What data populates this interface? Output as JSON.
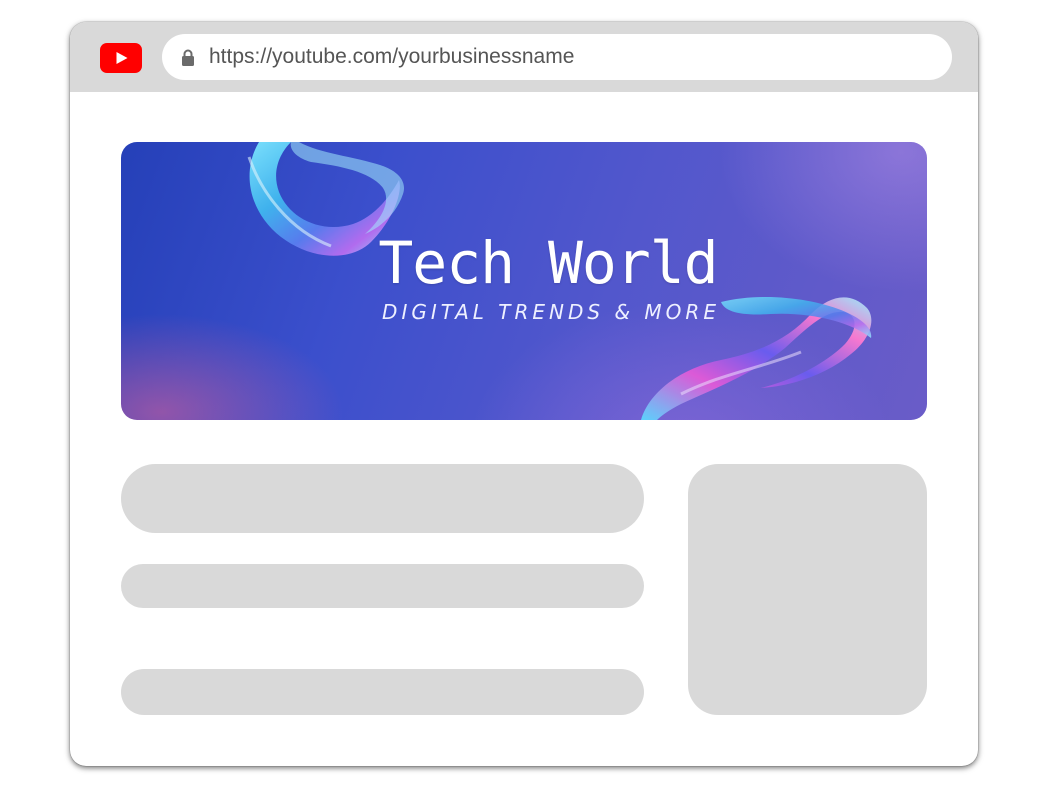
{
  "browser": {
    "logo_icon": "youtube-logo-icon",
    "url_icon": "lock-icon",
    "url": "https://youtube.com/yourbusinessname"
  },
  "banner": {
    "title": "Tech World",
    "subtitle": "DIGITAL TRENDS & MORE"
  },
  "colors": {
    "youtube_red": "#ff0000",
    "frame_gray": "#d9d9d9",
    "placeholder_gray": "#d9d9d9",
    "banner_blue": "#3b4fcc",
    "banner_purple": "#6a5cc8"
  }
}
